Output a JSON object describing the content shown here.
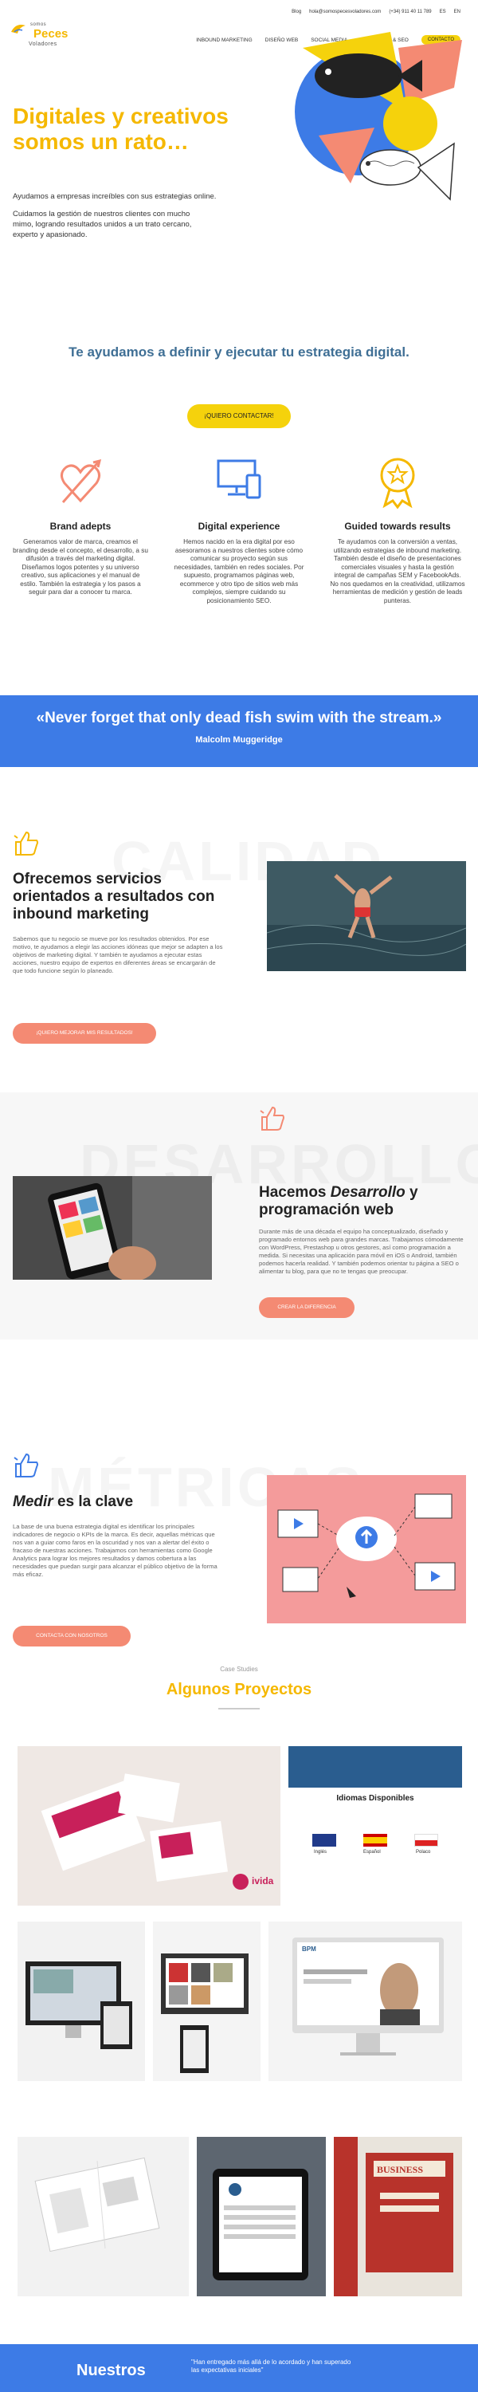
{
  "header": {
    "logo": {
      "line1": "somos",
      "line2": "Peces",
      "line3": "Voladores"
    },
    "topbar": {
      "blog": "Blog",
      "email": "hola@somospecesvoladores.com",
      "phone": "(+34) 911 40 11 789",
      "lang_es": "ES",
      "lang_en": "EN"
    },
    "nav": [
      {
        "label": "INBOUND MARKETING"
      },
      {
        "label": "DISEÑO WEB"
      },
      {
        "label": "SOCIAL MEDIA"
      },
      {
        "label": "CONTENIDO & SEO"
      }
    ],
    "cta": "CONTACTO"
  },
  "hero": {
    "title": "Digitales y creativos somos un rato…",
    "p1": "Ayudamos a empresas increíbles con sus estrategias online.",
    "p2": "Cuidamos la gestión de nuestros clientes con mucho mimo, logrando resultados unidos a un trato cercano, experto y apasionado."
  },
  "strategy": {
    "title": "Te ayudamos a definir y ejecutar tu estrategia digital.",
    "button": "¡QUIERO CONTACTAR!"
  },
  "features": [
    {
      "title": "Brand adepts",
      "text": "Generamos valor de marca, creamos el branding desde el concepto, el desarrollo, a su difusión a través del marketing digital. Diseñamos logos potentes y su universo creativo, sus aplicaciones y el manual de estilo. También la estrategia y los pasos a seguir para dar a conocer tu marca."
    },
    {
      "title": "Digital experience",
      "text": "Hemos nacido en la era digital por eso asesoramos a nuestros clientes sobre cómo comunicar su proyecto según sus necesidades, también en redes sociales. Por supuesto, programamos páginas web, ecommerce y otro tipo de sitios web más complejos, siempre cuidando su posicionamiento SEO."
    },
    {
      "title": "Guided towards results",
      "text": "Te ayudamos con la conversión a ventas, utilizando estrategias de inbound marketing. También desde el diseño de presentaciones comerciales visuales y hasta la gestión integral de campañas SEM y FacebookAds. No nos quedamos en la creatividad, utilizamos herramientas de medición y gestión de leads punteras."
    }
  ],
  "quote": {
    "text": "«Never forget that only dead fish swim with the stream.»",
    "author": "Malcolm Muggeridge"
  },
  "services": [
    {
      "watermark": "CALIDAD",
      "title": "Ofrecemos servicios orientados a resultados con inbound marketing",
      "text": "Sabemos que tu negocio se mueve por los resultados obtenidos. Por ese motivo, te ayudamos a elegir las acciones idóneas que mejor se adapten a los objetivos de marketing digital. Y también te ayudamos a ejecutar estas acciones, nuestro equipo de expertos en diferentes áreas se encargarán de que todo funcione según lo planeado.",
      "button": "¡QUIERO MEJORAR MIS RESULTADOS!"
    },
    {
      "watermark": "DESARROLLO",
      "title_a": "Hacemos ",
      "title_b": "Desarrollo",
      "title_c": " y programación web",
      "text": "Durante más de una década el equipo ha conceptualizado, diseñado y programado entornos web para grandes marcas. Trabajamos cómodamente con WordPress, Prestashop u otros gestores, así como programación a medida. Si necesitas una aplicación para móvil en iOS o Android, también podemos hacerla realidad. Y también podemos orientar tu página a SEO o alimentar tu blog, para que no te tengas que preocupar.",
      "button": "CREAR LA DIFERENCIA"
    },
    {
      "watermark": "MÉTRICAS",
      "title_a": "Medir",
      "title_b": " es la clave",
      "text": "La base de una buena estrategia digital es identificar los principales indicadores de negocio o KPIs de la marca. Es decir, aquellas métricas que nos van a guiar como faros en la oscuridad y nos van a alertar del éxito o fracaso de nuestras acciones. Trabajamos con herramientas como Google Analytics para lograr los mejores resultados y damos cobertura a las necesidades que puedan surgir para alcanzar el público objetivo de la forma más eficaz.",
      "button": "CONTACTA CON NOSOTROS"
    }
  ],
  "projects": {
    "kicker": "Case Studies",
    "title": "Algunos Proyectos",
    "ivida": "ivida",
    "idiomas": {
      "title": "Idiomas Disponibles",
      "langs": [
        "Inglés",
        "Español",
        "Polaco"
      ]
    },
    "bpm": "BPM",
    "business": "BUSINESS"
  },
  "bottom": {
    "title": "Nuestros",
    "quote": "\"Han entregado más allá de lo acordado y han superado las expectativas iniciales\""
  },
  "colors": {
    "yellow": "#f5b800",
    "blue": "#3d7be6",
    "salmon": "#f48a73",
    "title_blue": "#3f6f95"
  }
}
